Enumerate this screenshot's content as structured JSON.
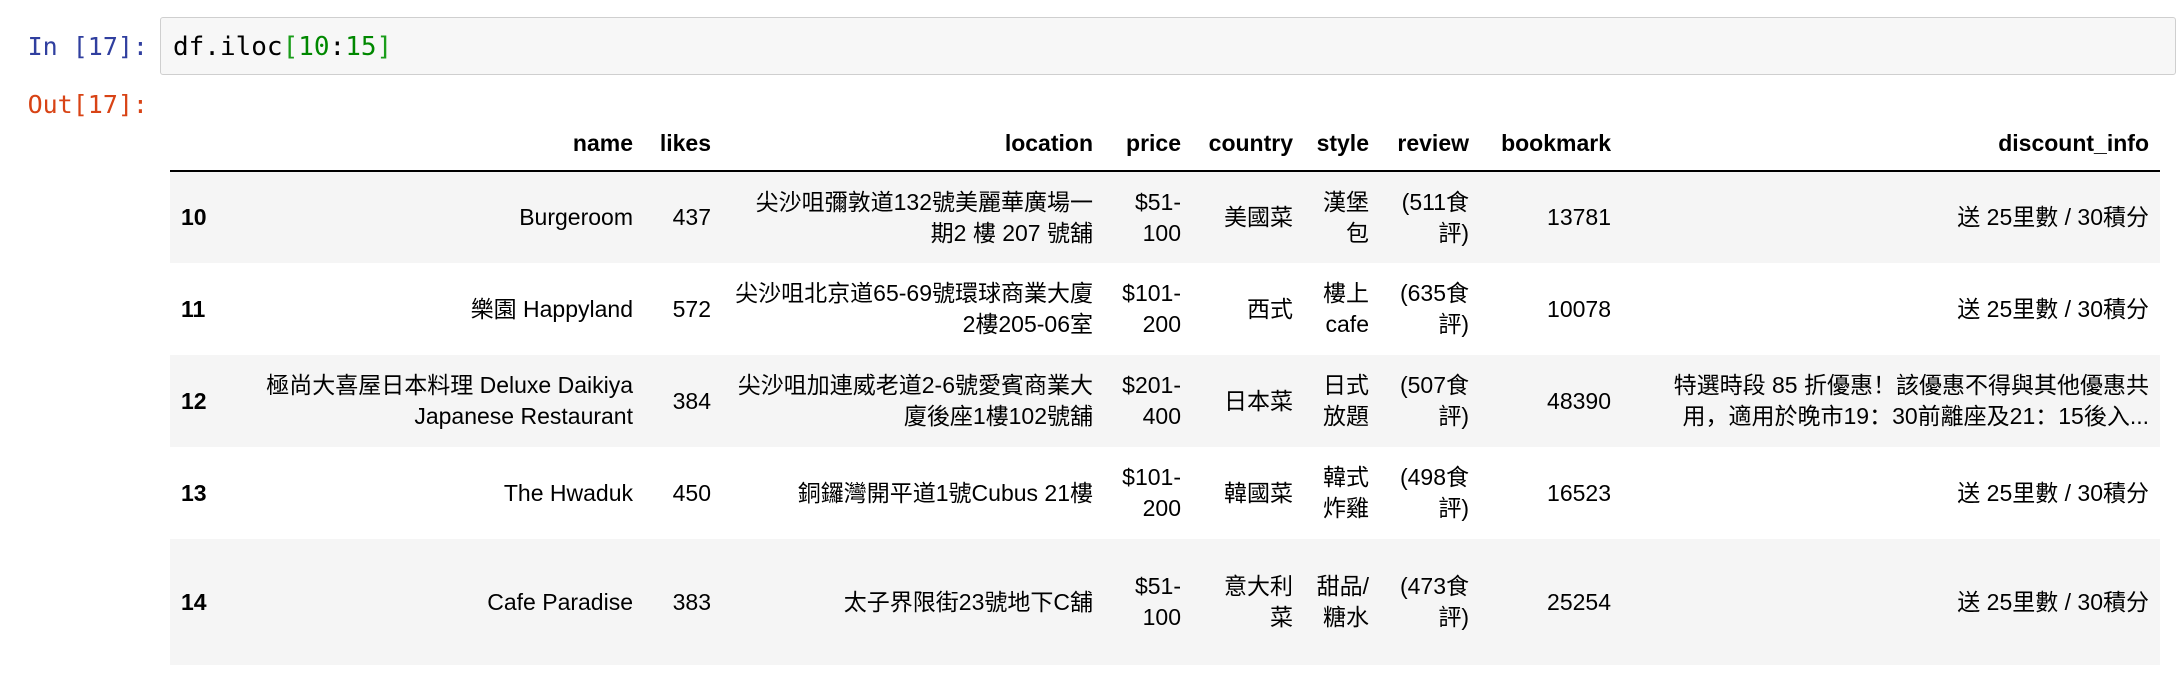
{
  "cell": {
    "in_prompt": "In [17]:",
    "out_prompt": "Out[17]:",
    "code": {
      "obj": "df.iloc",
      "open": "[",
      "start": "10",
      "colon": ":",
      "end": "15",
      "close": "]"
    }
  },
  "table": {
    "columns": [
      "name",
      "likes",
      "location",
      "price",
      "country",
      "style",
      "review",
      "bookmark",
      "discount_info"
    ],
    "rows": [
      {
        "index": "10",
        "name": "Burgeroom",
        "likes": "437",
        "location": "尖沙咀彌敦道132號美麗華廣場一期2 樓 207 號舖",
        "price": "$51-100",
        "country": "美國菜",
        "style": "漢堡包",
        "review": "(511食評)",
        "bookmark": "13781",
        "discount_info": "送 25里數 / 30積分"
      },
      {
        "index": "11",
        "name": "樂園 Happyland",
        "likes": "572",
        "location": "尖沙咀北京道65-69號環球商業大廈2樓205-06室",
        "price": "$101-200",
        "country": "西式",
        "style": "樓上cafe",
        "review": "(635食評)",
        "bookmark": "10078",
        "discount_info": "送 25里數 / 30積分"
      },
      {
        "index": "12",
        "name": "極尚大喜屋日本料理 Deluxe Daikiya Japanese Restaurant",
        "likes": "384",
        "location": "尖沙咀加連威老道2-6號愛賓商業大廈後座1樓102號舖",
        "price": "$201-400",
        "country": "日本菜",
        "style": "日式放題",
        "review": "(507食評)",
        "bookmark": "48390",
        "discount_info": "特選時段 85 折優惠！該優惠不得與其他優惠共用，適用於晚市19：30前離座及21：15後入..."
      },
      {
        "index": "13",
        "name": "The Hwaduk",
        "likes": "450",
        "location": "銅鑼灣開平道1號Cubus 21樓",
        "price": "$101-200",
        "country": "韓國菜",
        "style": "韓式炸雞",
        "review": "(498食評)",
        "bookmark": "16523",
        "discount_info": "送 25里數 / 30積分"
      },
      {
        "index": "14",
        "name": "Cafe Paradise",
        "likes": "383",
        "location": "太子界限街23號地下C舖",
        "price": "$51-100",
        "country": "意大利菜",
        "style": "甜品/糖水",
        "review": "(473食評)",
        "bookmark": "25254",
        "discount_info": "送 25里數 / 30積分"
      }
    ]
  }
}
